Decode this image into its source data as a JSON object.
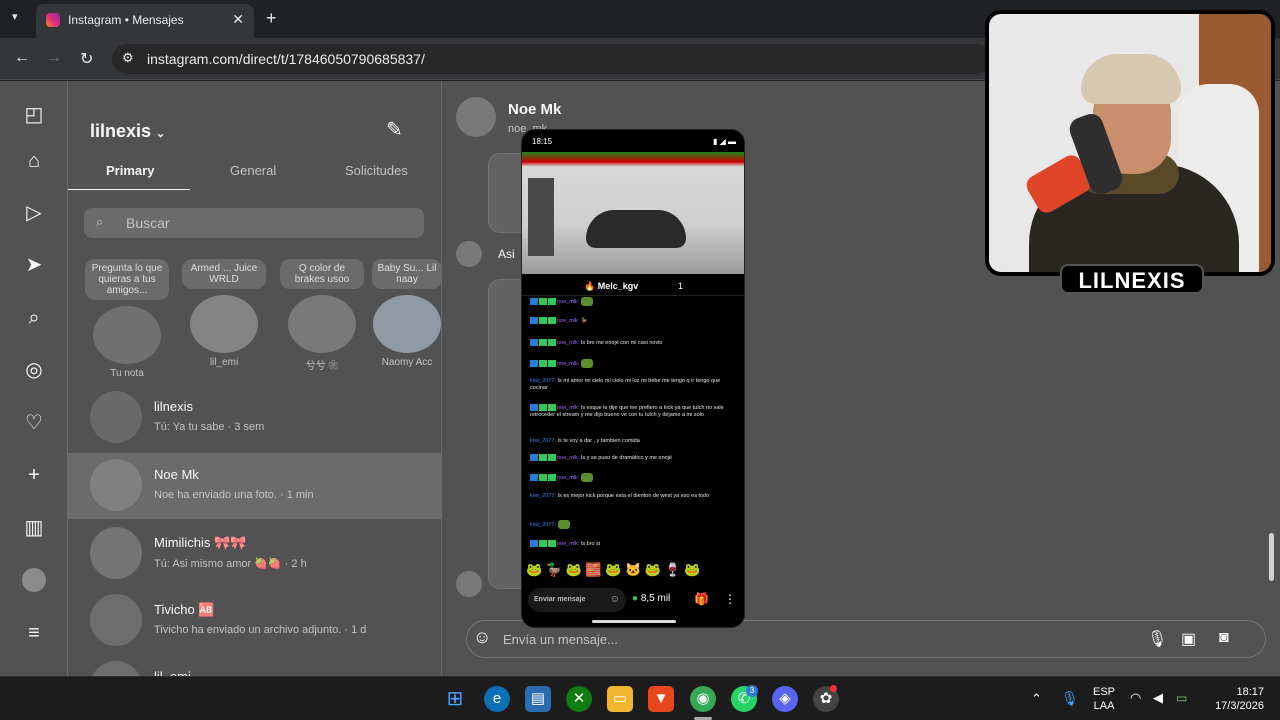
{
  "browser": {
    "tab_title": "Instagram • Mensajes",
    "tab_close": "✕",
    "new_tab": "+",
    "url": "instagram.com/direct/t/17846050790685837/"
  },
  "inbox": {
    "username": "lilnexis",
    "tabs": [
      "Primary",
      "General",
      "Solicitudes"
    ],
    "search_placeholder": "Buscar",
    "notes": [
      {
        "bubble": "Pregunta lo que quieras a tus amigos...",
        "name": "Tu nota"
      },
      {
        "bubble": "Armed ... Juice WRLD",
        "name": "lil_emi"
      },
      {
        "bubble": "Q color de brakes usoo",
        "name": "兮兮 ❀"
      },
      {
        "bubble": "Baby Su... Lil naay",
        "name": "Naomy Acc"
      }
    ],
    "conversations": [
      {
        "name": "lilnexis",
        "preview": "Tú: Ya tu sabe · 3 sem"
      },
      {
        "name": "Noe Mk",
        "preview": "Noe ha enviado una foto. · 1 min"
      },
      {
        "name": "Mimilichis 🎀🎀",
        "preview": "Tú: Asi mismo amor 🍓🍓 · 2 h"
      },
      {
        "name": "Tivicho 🆎",
        "preview": "Tivicho ha enviado un archivo adjunto. · 1 d"
      },
      {
        "name": "lil_emi",
        "preview": ""
      }
    ]
  },
  "chat": {
    "name": "Noe Mk",
    "handle": "noe_mk",
    "message_text": "Asi",
    "composer_placeholder": "Envía un mensaje..."
  },
  "phone": {
    "time": "18:15",
    "status_icons": "▮ ◢ ▬",
    "channel": "Melc_kgv",
    "viewer_index": "1",
    "chat": [
      {
        "user": "noe_mlk:",
        "text": "",
        "emote": true
      },
      {
        "user": "noe_mlk:",
        "text": "🦆",
        "emote": false
      },
      {
        "user": "noe_mlk:",
        "text": "Is bro me enojé con mi casi novio",
        "emote": false
      },
      {
        "user": "noe_mlk:",
        "text": "",
        "emote": true
      },
      {
        "user": "kiwi_2077:",
        "text": "Is mi amor mi cielo mi cielo mi luz mi bebe me tengo q ir tengo que cocinar",
        "emote": false
      },
      {
        "user": "noe_mlk:",
        "text": "Is esque le dije que me prefiero a kick ya que tulch no vale retroceder el stream y me dijo bueno ve con tu tulch y déjame a mi solo",
        "emote": false
      },
      {
        "user": "kiwi_2077:",
        "text": "Is te voy a dar , y tambien comida",
        "emote": false
      },
      {
        "user": "noe_mlk:",
        "text": "Is y se puso de dramático y me enojé",
        "emote": false
      },
      {
        "user": "noe_mlk:",
        "text": "",
        "emote": true
      },
      {
        "user": "kiwi_2077:",
        "text": "Is es mejor kick porque esta el dienton de west ya eso es todo",
        "emote": false
      },
      {
        "user": "kiwi_2077:",
        "text": "",
        "emote": true
      },
      {
        "user": "noe_mlk:",
        "text": "Is bro si",
        "emote": false
      }
    ],
    "emotes": "🐸 🦆 🐸 🧱 🐸 🐱 🐸 🍷 🐸",
    "input_placeholder": "Enviar mensaje",
    "viewers": "8,5 mil"
  },
  "webcam": {
    "label": "LILNEXIS"
  },
  "taskbar": {
    "lang": "ESP",
    "layout": "LAA",
    "time": "18:17",
    "date": "17/3/2026",
    "whatsapp_badge": "3"
  }
}
